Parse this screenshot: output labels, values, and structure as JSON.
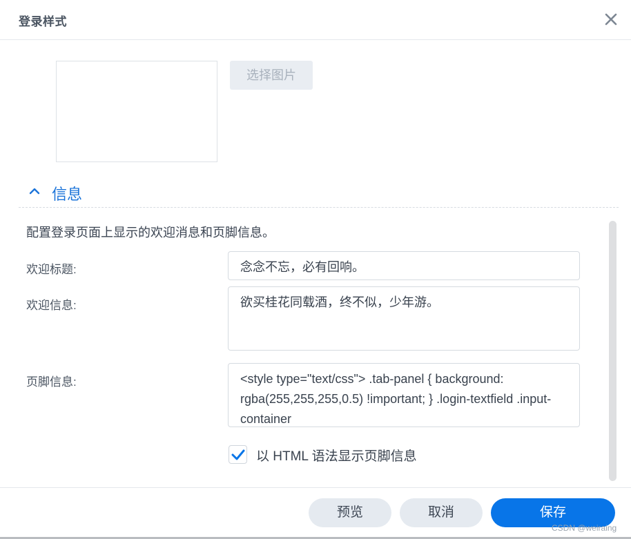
{
  "dialog": {
    "title": "登录样式",
    "close_icon": "close-icon"
  },
  "image_picker": {
    "select_label": "选择图片"
  },
  "info_section": {
    "title": "信息",
    "description": "配置登录页面上显示的欢迎消息和页脚信息。",
    "welcome_title_label": "欢迎标题:",
    "welcome_title_value": "念念不忘，必有回响。",
    "welcome_message_label": "欢迎信息:",
    "welcome_message_value": "欲买桂花同载酒，终不似，少年游。",
    "footer_label": "页脚信息:",
    "footer_value": "<style type=\"text/css\"> .tab-panel { background: rgba(255,255,255,0.5) !important; } .login-textfield .input-container",
    "html_checkbox_label": "以 HTML 语法显示页脚信息",
    "html_checkbox_checked": true
  },
  "footer_buttons": {
    "preview": "预览",
    "cancel": "取消",
    "save": "保存"
  },
  "watermark": "CSDN @weiraing",
  "colors": {
    "accent": "#0875e8",
    "section_title": "#1a73d9",
    "secondary_button": "#e5eaf0"
  }
}
